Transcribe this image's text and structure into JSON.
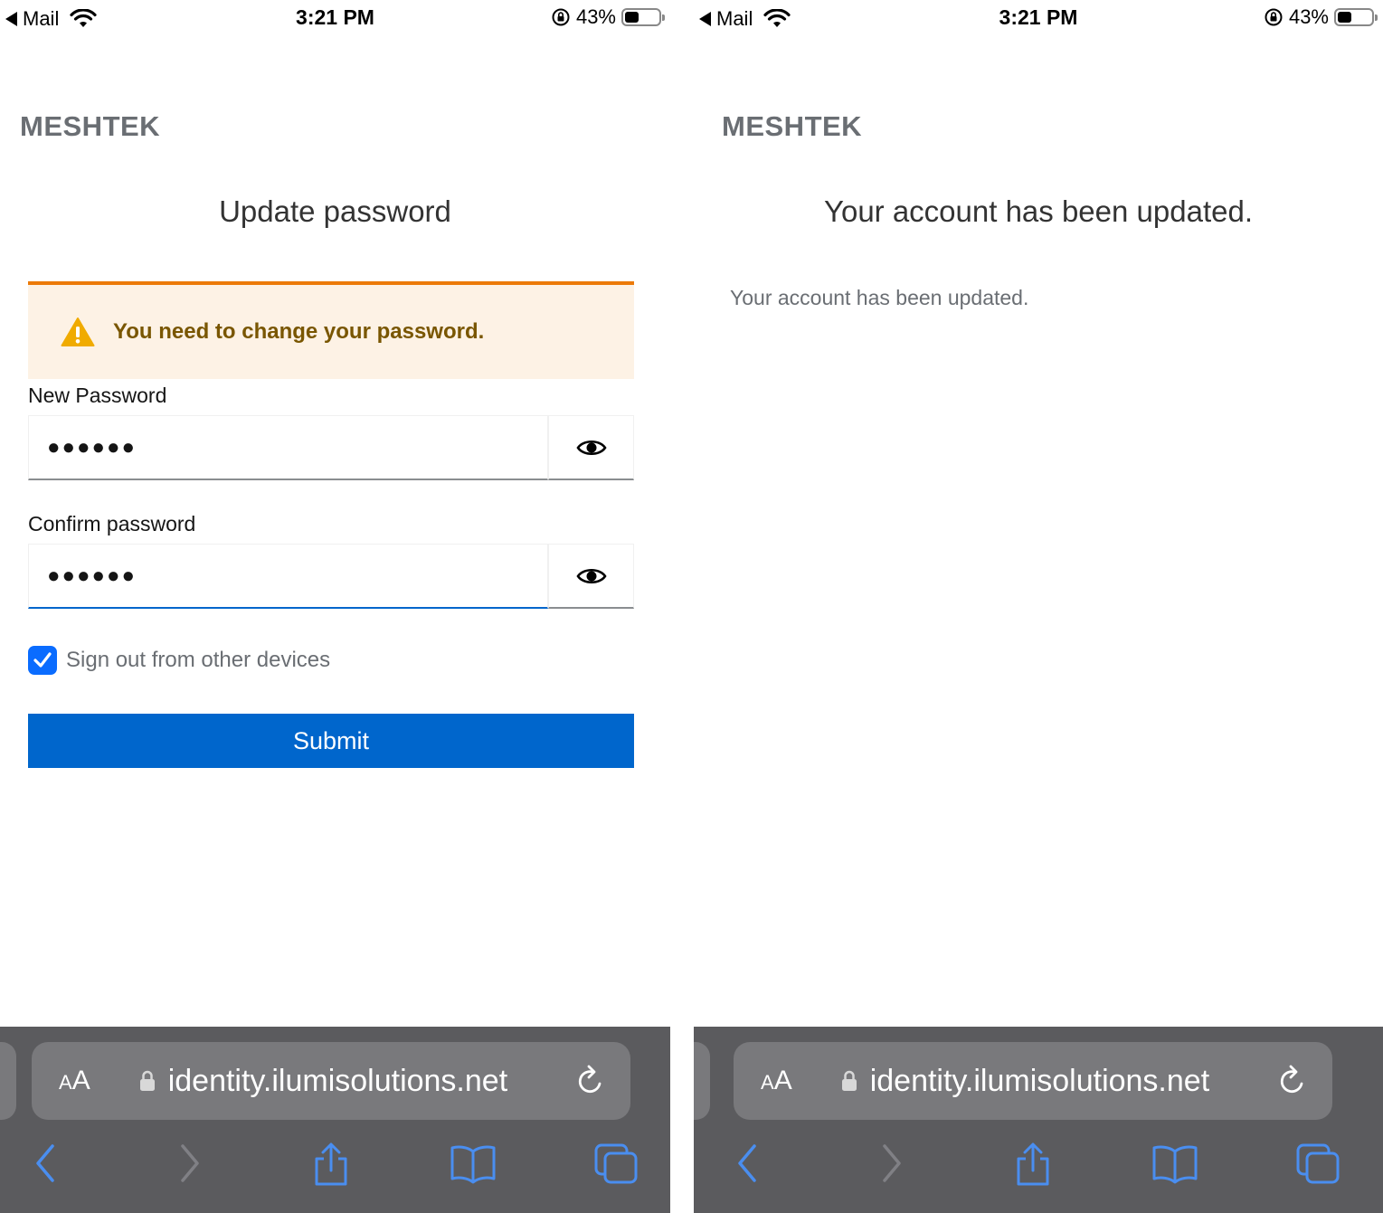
{
  "status_bar": {
    "back_label": "Mail",
    "time": "3:21 PM",
    "battery": "43%",
    "battery_level": 0.43
  },
  "left": {
    "brand": "MESHTEK",
    "title": "Update password",
    "alert": "You need to change your password.",
    "new_password_label": "New Password",
    "new_password_value": "●●●●●●",
    "confirm_password_label": "Confirm password",
    "confirm_password_value": "●●●●●●",
    "signout_label": "Sign out from other devices",
    "signout_checked": true,
    "submit_label": "Submit"
  },
  "right": {
    "brand": "MESHTEK",
    "title": "Your account has been updated.",
    "message": "Your account has been updated."
  },
  "safari": {
    "text_size_small": "A",
    "text_size_large": "A",
    "url": "identity.ilumisolutions.net"
  },
  "colors": {
    "accent": "#0066cc",
    "warning_border": "#ec7a08",
    "warning_bg": "#fdf2e5",
    "warning_text": "#795600",
    "safari_bar": "#5b5b5e",
    "safari_icon": "#4a8ef0"
  },
  "icons": [
    "back-arrow-icon",
    "wifi-icon",
    "orientation-lock-icon",
    "battery-icon",
    "warning-icon",
    "eye-icon",
    "checkmark-icon",
    "lock-icon",
    "reload-icon",
    "chevron-left-icon",
    "chevron-right-icon",
    "share-icon",
    "bookmarks-icon",
    "tabs-icon"
  ]
}
